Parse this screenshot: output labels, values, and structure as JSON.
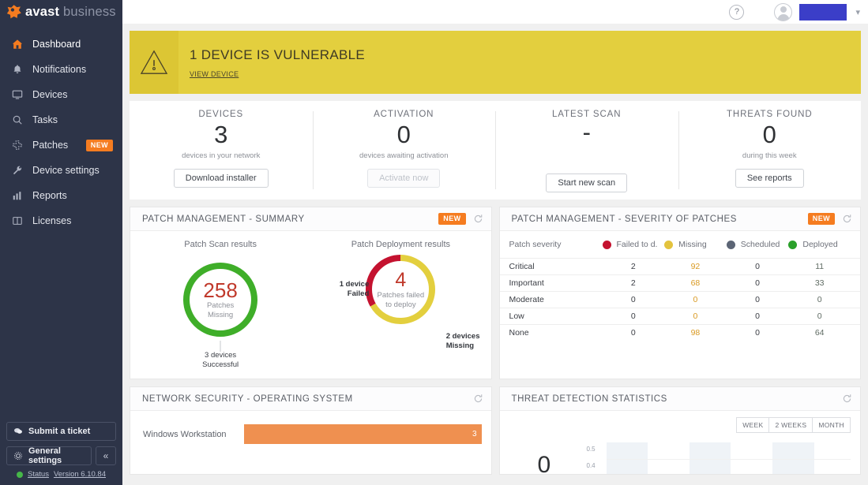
{
  "brand": {
    "name_primary": "avast",
    "name_secondary": "business",
    "logo_icon": "avast-splat-logo",
    "accent": "#f57c20"
  },
  "sidebar": {
    "items": [
      {
        "label": "Dashboard",
        "icon": "home-icon",
        "active": true
      },
      {
        "label": "Notifications",
        "icon": "bell-icon",
        "active": false
      },
      {
        "label": "Devices",
        "icon": "monitor-icon",
        "active": false
      },
      {
        "label": "Tasks",
        "icon": "search-icon",
        "active": false
      },
      {
        "label": "Patches",
        "icon": "patches-icon",
        "active": false,
        "badge": "NEW"
      },
      {
        "label": "Device settings",
        "icon": "wrench-icon",
        "active": false
      },
      {
        "label": "Reports",
        "icon": "bar-chart-icon",
        "active": false
      },
      {
        "label": "Licenses",
        "icon": "license-card-icon",
        "active": false
      }
    ],
    "submit_ticket": "Submit a ticket",
    "general_settings": "General settings",
    "collapse_icon": "chevron-double-left-icon",
    "status_label": "Status",
    "version_label": "Version 6.10.84",
    "status_color": "#46b749"
  },
  "topbar": {
    "help_icon": "question-mark-icon",
    "avatar": "user-avatar",
    "user_name_redacted": "",
    "chevron_icon": "chevron-down-icon"
  },
  "banner": {
    "icon": "warning-triangle-icon",
    "title": "1 DEVICE IS VULNERABLE",
    "link": "VIEW DEVICE",
    "bg": "#e3cf3e"
  },
  "stats": [
    {
      "title": "DEVICES",
      "value": "3",
      "sub": "devices in your network",
      "button": "Download installer",
      "disabled": false
    },
    {
      "title": "ACTIVATION",
      "value": "0",
      "sub": "devices awaiting activation",
      "button": "Activate now",
      "disabled": true
    },
    {
      "title": "LATEST SCAN",
      "value": "-",
      "sub": "",
      "button": "Start new scan",
      "disabled": false
    },
    {
      "title": "THREATS FOUND",
      "value": "0",
      "sub": "during this week",
      "button": "See reports",
      "disabled": false
    }
  ],
  "patch_summary": {
    "title": "PATCH MANAGEMENT - SUMMARY",
    "badge": "NEW",
    "refresh_icon": "refresh-icon",
    "scan": {
      "subtitle": "Patch Scan results",
      "value": "258",
      "caption_1": "Patches",
      "caption_2": "Missing",
      "footer": "3 devices\nSuccessful",
      "footer_line1": "3 devices",
      "footer_line2": "Successful",
      "ring_color": "#3fae29"
    },
    "deploy": {
      "subtitle": "Patch Deployment results",
      "value": "4",
      "caption_1": "Patches failed",
      "caption_2": "to deploy",
      "label_left_line1": "1 device",
      "label_left_line2": "Failed",
      "label_right_line1": "2 devices",
      "label_right_line2": "Missing",
      "failed_color": "#c4122f",
      "missing_color": "#e3cf3e"
    }
  },
  "severity": {
    "title": "PATCH MANAGEMENT - SEVERITY OF PATCHES",
    "badge": "NEW",
    "refresh_icon": "refresh-icon",
    "columns": [
      {
        "label": "Patch severity",
        "dot": null
      },
      {
        "label": "Failed to d.",
        "dot": "#c4122f"
      },
      {
        "label": "Missing",
        "dot": "#e3c33e"
      },
      {
        "label": "Scheduled",
        "dot": "#5c6575"
      },
      {
        "label": "Deployed",
        "dot": "#2aa02a"
      }
    ],
    "rows": [
      {
        "severity": "Critical",
        "failed": "2",
        "missing": "92",
        "scheduled": "0",
        "deployed": "11"
      },
      {
        "severity": "Important",
        "failed": "2",
        "missing": "68",
        "scheduled": "0",
        "deployed": "33"
      },
      {
        "severity": "Moderate",
        "failed": "0",
        "missing": "0",
        "scheduled": "0",
        "deployed": "0"
      },
      {
        "severity": "Low",
        "failed": "0",
        "missing": "0",
        "scheduled": "0",
        "deployed": "0"
      },
      {
        "severity": "None",
        "failed": "0",
        "missing": "98",
        "scheduled": "0",
        "deployed": "64"
      }
    ]
  },
  "network_security": {
    "title": "NETWORK SECURITY - OPERATING SYSTEM",
    "refresh_icon": "refresh-icon",
    "rows": [
      {
        "label": "Windows Workstation",
        "value": "3",
        "pct": 100,
        "color": "#ef9050"
      }
    ]
  },
  "threat_stats": {
    "title": "THREAT DETECTION STATISTICS",
    "refresh_icon": "refresh-icon",
    "ranges": [
      "WEEK",
      "2 WEEKS",
      "MONTH"
    ],
    "active_range": "WEEK",
    "total": "0",
    "y_ticks": [
      "0.5",
      "0.4"
    ]
  },
  "chart_data": [
    {
      "type": "pie",
      "title": "Patch Scan results",
      "labels": [
        "Successful"
      ],
      "values": [
        3
      ],
      "center_value": 258,
      "center_label": "Patches Missing",
      "annotations": [
        "3 devices Successful"
      ],
      "colors": [
        "#3fae29"
      ]
    },
    {
      "type": "pie",
      "title": "Patch Deployment results",
      "labels": [
        "Failed",
        "Missing"
      ],
      "values": [
        1,
        2
      ],
      "center_value": 4,
      "center_label": "Patches failed to deploy",
      "annotations": [
        "1 device Failed",
        "2 devices Missing"
      ],
      "colors": [
        "#c4122f",
        "#e3cf3e"
      ]
    },
    {
      "type": "table",
      "title": "PATCH MANAGEMENT - SEVERITY OF PATCHES",
      "columns": [
        "Patch severity",
        "Failed to d.",
        "Missing",
        "Scheduled",
        "Deployed"
      ],
      "rows": [
        [
          "Critical",
          2,
          92,
          0,
          11
        ],
        [
          "Important",
          2,
          68,
          0,
          33
        ],
        [
          "Moderate",
          0,
          0,
          0,
          0
        ],
        [
          "Low",
          0,
          0,
          0,
          0
        ],
        [
          "None",
          0,
          98,
          0,
          64
        ]
      ]
    },
    {
      "type": "bar",
      "title": "NETWORK SECURITY - OPERATING SYSTEM",
      "categories": [
        "Windows Workstation"
      ],
      "values": [
        3
      ],
      "xlabel": "",
      "ylabel": "",
      "orientation": "horizontal",
      "colors": [
        "#ef9050"
      ]
    },
    {
      "type": "line",
      "title": "THREAT DETECTION STATISTICS",
      "x": [],
      "values": [],
      "ylabel": "",
      "xlabel": "",
      "ytick_labels": [
        "0.5",
        "0.4"
      ],
      "ylim": [
        0,
        0.5
      ],
      "total": 0,
      "grid": true
    }
  ]
}
